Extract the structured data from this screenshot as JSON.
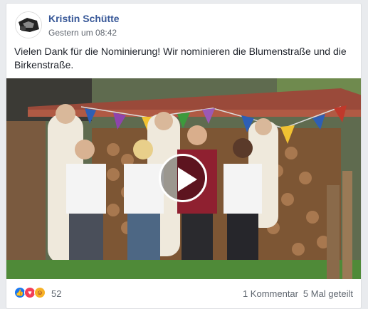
{
  "post": {
    "author": "Kristin Schütte",
    "timestamp": "Gestern um 08:42",
    "text": "Vielen Dank für die Nominierung! Wir nominieren die Blumenstraße und die Birkenstraße."
  },
  "video": {
    "play_icon": "play-icon"
  },
  "footer": {
    "reaction_icons": [
      "like-icon",
      "love-icon",
      "haha-icon"
    ],
    "reaction_count": "52",
    "comments": "1 Kommentar",
    "shares": "5 Mal geteilt"
  },
  "colors": {
    "author": "#385898",
    "like": "#1877f2",
    "love": "#f33e58",
    "haha": "#f7b125"
  }
}
